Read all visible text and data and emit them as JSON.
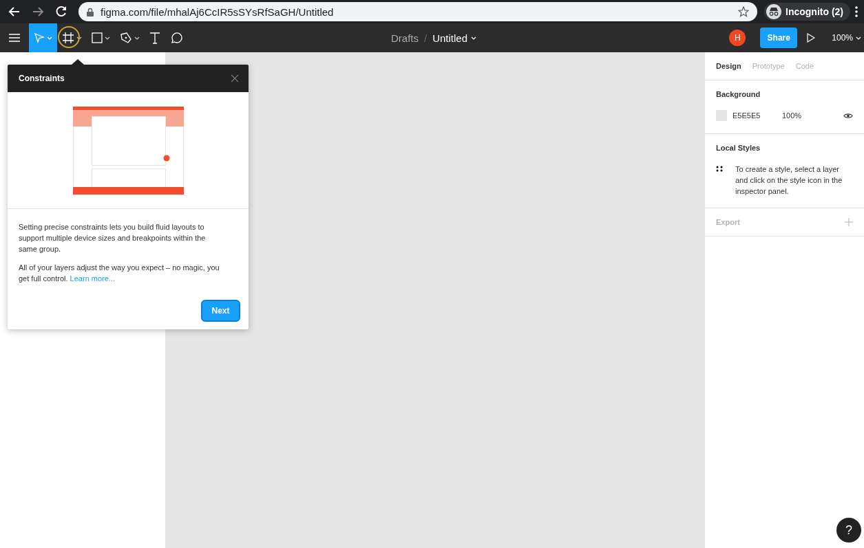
{
  "browser": {
    "url": "figma.com/file/mhalAj6CcIR5sSYsRfSaGH/Untitled",
    "profile": "Incognito (2)"
  },
  "toolbar": {
    "tools": [
      {
        "kind": "move",
        "selected": true,
        "highlighted": false,
        "menu": true
      },
      {
        "kind": "frame",
        "selected": false,
        "highlighted": true,
        "menu": true
      },
      {
        "kind": "shape",
        "selected": false,
        "highlighted": false,
        "menu": true
      },
      {
        "kind": "pen",
        "selected": false,
        "highlighted": false,
        "menu": true
      },
      {
        "kind": "text",
        "selected": false,
        "highlighted": false,
        "menu": false
      },
      {
        "kind": "comment",
        "selected": false,
        "highlighted": false,
        "menu": false
      }
    ],
    "breadcrumb": {
      "folder": "Drafts",
      "separator": "/",
      "file": "Untitled"
    },
    "avatar": "H",
    "share": "Share",
    "zoom": "100%"
  },
  "popover": {
    "title": "Constraints",
    "paragraphs": [
      {
        "text": "Setting precise constraints lets you build fluid layouts to support multiple device sizes and breakpoints within the same group."
      },
      {
        "text": "All of your layers adjust the way you expect – no magic, you get full control.",
        "link": "Learn more..."
      }
    ],
    "button": "Next"
  },
  "inspector": {
    "tabs": [
      {
        "label": "Design",
        "selected": true
      },
      {
        "label": "Prototype",
        "selected": false
      },
      {
        "label": "Code",
        "selected": false
      }
    ],
    "background": {
      "title": "Background",
      "hex": "E5E5E5",
      "opacity": "100%"
    },
    "local_styles": {
      "title": "Local Styles",
      "hint": "To create a style, select a layer and click on the style icon in the inspector panel."
    },
    "export": {
      "title": "Export",
      "disabled": true
    }
  },
  "help": "?"
}
